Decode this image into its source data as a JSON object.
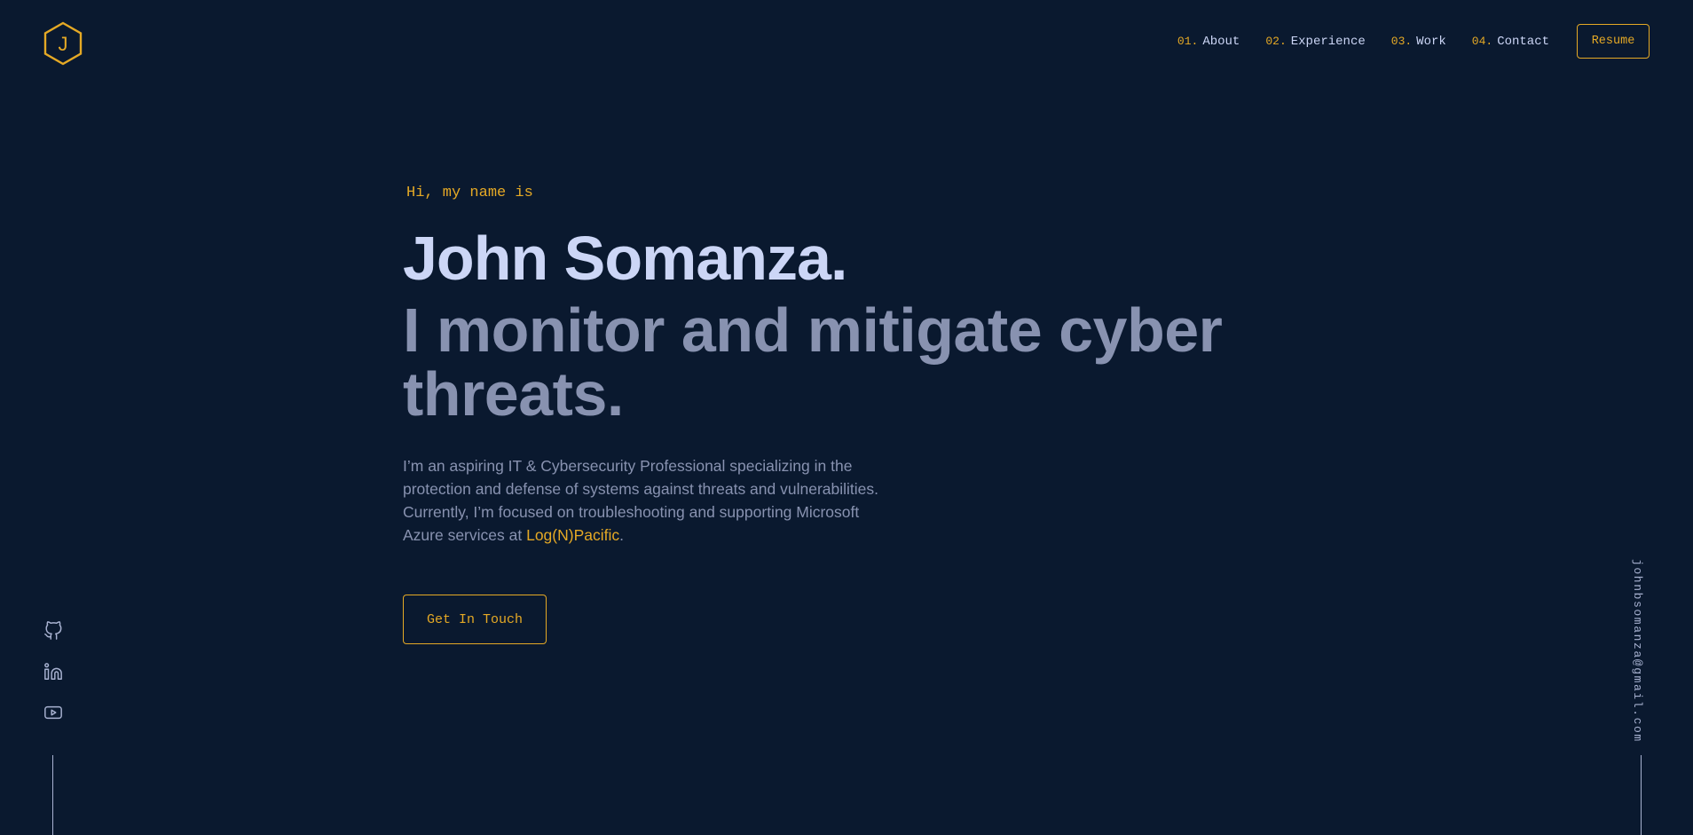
{
  "logo": {
    "letter": "J",
    "icon": "hexagon-logo-icon"
  },
  "nav": {
    "items": [
      {
        "num": "01.",
        "label": "About"
      },
      {
        "num": "02.",
        "label": "Experience"
      },
      {
        "num": "03.",
        "label": "Work"
      },
      {
        "num": "04.",
        "label": "Contact"
      }
    ],
    "resume_label": "Resume"
  },
  "hero": {
    "greeting": "Hi, my name is",
    "name": "John Somanza.",
    "tagline": "I monitor and mitigate cyber threats.",
    "bio": "I’m an aspiring IT & Cybersecurity Professional specializing in the protection and defense of systems against threats and vulnerabilities. Currently, I’m focused on troubleshooting and supporting Microsoft Azure services at",
    "company": "Log(N)Pacific",
    "bio_end": ".",
    "cta_label": "Get In Touch"
  },
  "socials": [
    {
      "icon": "github-icon"
    },
    {
      "icon": "linkedin-icon"
    },
    {
      "icon": "youtube-icon"
    }
  ],
  "email": "johnbsomanza@gmail.com",
  "colors": {
    "background": "#0a192f",
    "accent": "#e5a925",
    "heading": "#ccd6f6",
    "text": "#8892b0"
  }
}
